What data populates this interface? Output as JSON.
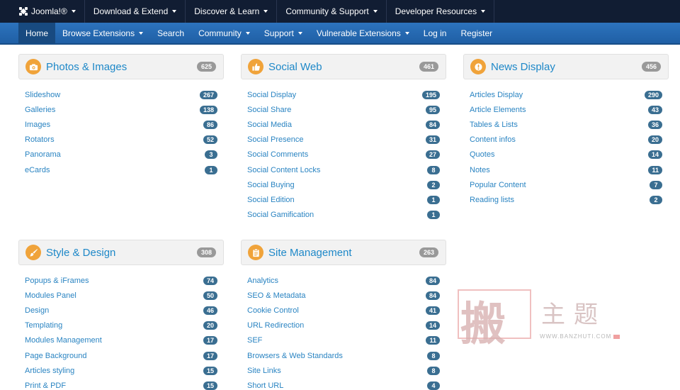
{
  "topbar": {
    "items": [
      {
        "label": "Joomla!®"
      },
      {
        "label": "Download & Extend"
      },
      {
        "label": "Discover & Learn"
      },
      {
        "label": "Community & Support"
      },
      {
        "label": "Developer Resources"
      }
    ]
  },
  "navbar": {
    "items": [
      {
        "label": "Home",
        "active": true
      },
      {
        "label": "Browse Extensions",
        "dropdown": true
      },
      {
        "label": "Search"
      },
      {
        "label": "Community",
        "dropdown": true
      },
      {
        "label": "Support",
        "dropdown": true
      },
      {
        "label": "Vulnerable Extensions",
        "dropdown": true
      },
      {
        "label": "Log in"
      },
      {
        "label": "Register"
      }
    ]
  },
  "panels": [
    {
      "title": "Photos & Images",
      "count": "625",
      "icon": "camera-icon",
      "items": [
        {
          "name": "Slideshow",
          "count": "267"
        },
        {
          "name": "Galleries",
          "count": "138"
        },
        {
          "name": "Images",
          "count": "86"
        },
        {
          "name": "Rotators",
          "count": "52"
        },
        {
          "name": "Panorama",
          "count": "3"
        },
        {
          "name": "eCards",
          "count": "1"
        }
      ]
    },
    {
      "title": "Social Web",
      "count": "461",
      "icon": "thumbs-up-icon",
      "items": [
        {
          "name": "Social Display",
          "count": "195"
        },
        {
          "name": "Social Share",
          "count": "95"
        },
        {
          "name": "Social Media",
          "count": "84"
        },
        {
          "name": "Social Presence",
          "count": "31"
        },
        {
          "name": "Social Comments",
          "count": "27"
        },
        {
          "name": "Social Content Locks",
          "count": "8"
        },
        {
          "name": "Social Buying",
          "count": "2"
        },
        {
          "name": "Social Edition",
          "count": "1"
        },
        {
          "name": "Social Gamification",
          "count": "1"
        }
      ]
    },
    {
      "title": "News Display",
      "count": "456",
      "icon": "exclamation-icon",
      "items": [
        {
          "name": "Articles Display",
          "count": "290"
        },
        {
          "name": "Article Elements",
          "count": "43"
        },
        {
          "name": "Tables & Lists",
          "count": "36"
        },
        {
          "name": "Content infos",
          "count": "20"
        },
        {
          "name": "Quotes",
          "count": "14"
        },
        {
          "name": "Notes",
          "count": "11"
        },
        {
          "name": "Popular Content",
          "count": "7"
        },
        {
          "name": "Reading lists",
          "count": "2"
        }
      ]
    },
    {
      "title": "Style & Design",
      "count": "308",
      "icon": "paintbrush-icon",
      "items": [
        {
          "name": "Popups & iFrames",
          "count": "74"
        },
        {
          "name": "Modules Panel",
          "count": "50"
        },
        {
          "name": "Design",
          "count": "46"
        },
        {
          "name": "Templating",
          "count": "20"
        },
        {
          "name": "Modules Management",
          "count": "17"
        },
        {
          "name": "Page Background",
          "count": "17"
        },
        {
          "name": "Articles styling",
          "count": "15"
        },
        {
          "name": "Print & PDF",
          "count": "15"
        }
      ]
    },
    {
      "title": "Site Management",
      "count": "263",
      "icon": "clipboard-icon",
      "items": [
        {
          "name": "Analytics",
          "count": "84"
        },
        {
          "name": "SEO & Metadata",
          "count": "84"
        },
        {
          "name": "Cookie Control",
          "count": "41"
        },
        {
          "name": "URL Redirection",
          "count": "14"
        },
        {
          "name": "SEF",
          "count": "11"
        },
        {
          "name": "Browsers & Web Standards",
          "count": "8"
        },
        {
          "name": "Site Links",
          "count": "8"
        },
        {
          "name": "Short URL",
          "count": "4"
        }
      ]
    }
  ],
  "watermark": {
    "big_char": "搬",
    "cn_text": "主题",
    "url": "WWW.BANZHUTI.COM"
  },
  "colors": {
    "topbar": "#111d33",
    "navbar": "#2568b0",
    "accent_icon": "#f0a33a",
    "link": "#2a84c2",
    "badge": "#3a6e91"
  }
}
